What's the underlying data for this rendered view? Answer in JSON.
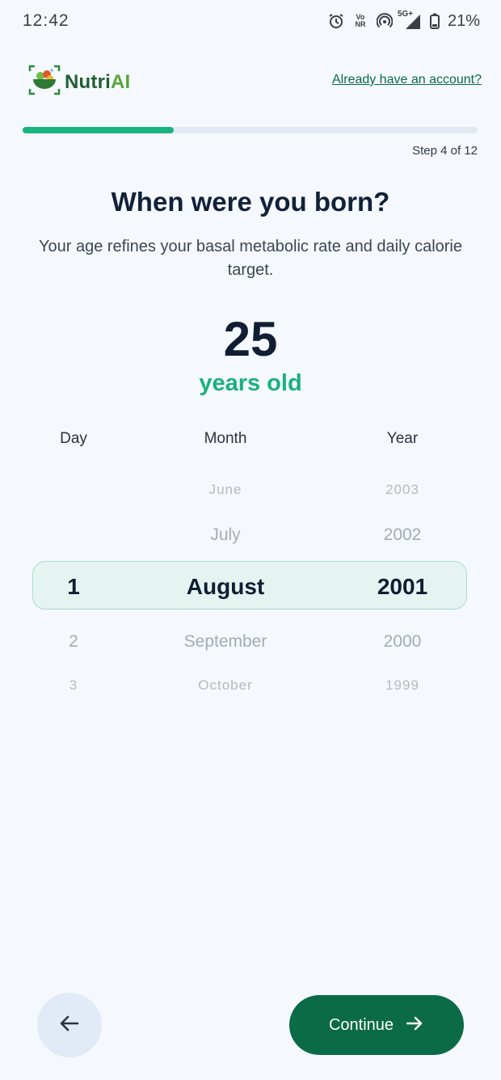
{
  "status_bar": {
    "time": "12:42",
    "network": "5G+",
    "volte": "Vo NR",
    "battery": "21%"
  },
  "header": {
    "brand_part1": "Nutri",
    "brand_part2": "AI",
    "login_link": "Already have an account?"
  },
  "progress": {
    "current_step": 4,
    "total_steps": 12,
    "label": "Step 4 of 12",
    "fraction": 0.333
  },
  "main": {
    "title": "When were you born?",
    "subtitle": "Your age refines your basal metabolic rate and daily calorie target.",
    "age_value": "25",
    "age_unit": "years old"
  },
  "picker": {
    "headers": {
      "day": "Day",
      "month": "Month",
      "year": "Year"
    },
    "day": [
      "",
      "",
      "1",
      "2",
      "3"
    ],
    "month": [
      "June",
      "July",
      "August",
      "September",
      "October"
    ],
    "year": [
      "2003",
      "2002",
      "2001",
      "2000",
      "1999"
    ],
    "selected": {
      "day": "1",
      "month": "August",
      "year": "2001"
    }
  },
  "footer": {
    "continue_label": "Continue",
    "back_icon": "arrow-left-icon",
    "forward_icon": "arrow-right-icon"
  },
  "colors": {
    "accent": "#18b47e",
    "primary_button": "#0b6b47",
    "background": "#f5f8fc",
    "highlight": "#e5f4f1"
  }
}
